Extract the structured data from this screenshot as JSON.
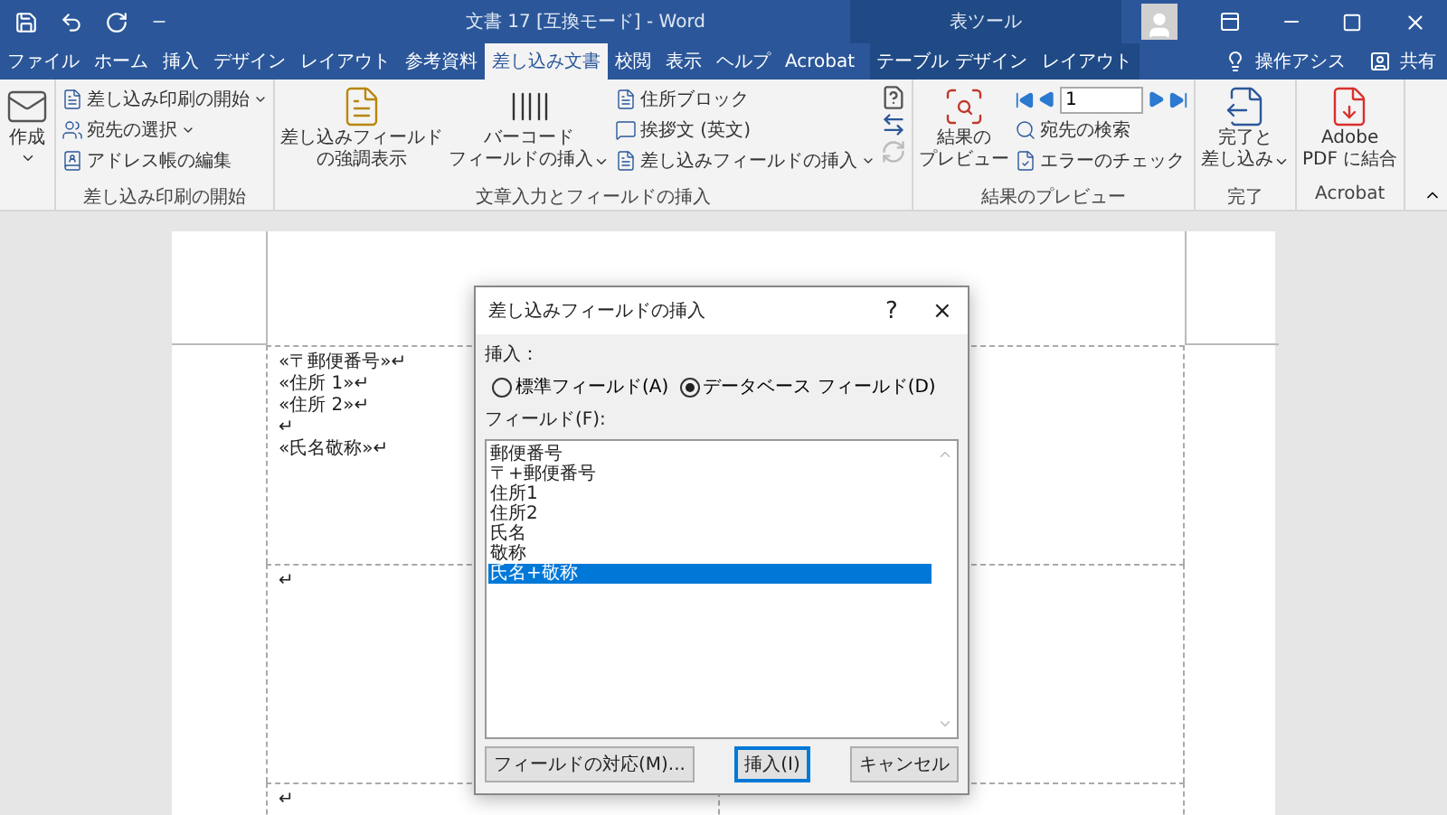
{
  "title_bar": {
    "title": "文書 17 [互換モード] - Word",
    "contextual_group": "表ツール"
  },
  "tabs": [
    {
      "label": "ファイル",
      "selected": false,
      "contextual": false
    },
    {
      "label": "ホーム",
      "selected": false,
      "contextual": false
    },
    {
      "label": "挿入",
      "selected": false,
      "contextual": false
    },
    {
      "label": "デザイン",
      "selected": false,
      "contextual": false
    },
    {
      "label": "レイアウト",
      "selected": false,
      "contextual": false
    },
    {
      "label": "参考資料",
      "selected": false,
      "contextual": false
    },
    {
      "label": "差し込み文書",
      "selected": true,
      "contextual": false
    },
    {
      "label": "校閲",
      "selected": false,
      "contextual": false
    },
    {
      "label": "表示",
      "selected": false,
      "contextual": false
    },
    {
      "label": "ヘルプ",
      "selected": false,
      "contextual": false
    },
    {
      "label": "Acrobat",
      "selected": false,
      "contextual": false
    },
    {
      "label": "テーブル デザイン",
      "selected": false,
      "contextual": true
    },
    {
      "label": "レイアウト",
      "selected": false,
      "contextual": true
    }
  ],
  "tell_me": "操作アシス",
  "share": "共有",
  "ribbon": {
    "groups": [
      {
        "items": [
          {
            "kind": "large",
            "lines": [
              "作成"
            ],
            "dropdown": true
          }
        ]
      },
      {
        "label": "差し込み印刷の開始",
        "items": [
          {
            "kind": "small",
            "label": "差し込み印刷の開始",
            "dropdown": true
          },
          {
            "kind": "small",
            "label": "宛先の選択",
            "dropdown": true
          },
          {
            "kind": "small",
            "label": "アドレス帳の編集",
            "dropdown": false
          }
        ]
      },
      {
        "label": "文章入力とフィールドの挿入",
        "items": [
          {
            "kind": "large",
            "lines": [
              "差し込みフィールド",
              "の強調表示"
            ],
            "dropdown": false
          },
          {
            "kind": "large",
            "lines": [
              "バーコード",
              "フィールドの挿入"
            ],
            "dropdown": true
          },
          {
            "kind": "small",
            "label": "住所ブロック",
            "dropdown": false
          },
          {
            "kind": "small",
            "label": "挨拶文 (英文)",
            "dropdown": false
          },
          {
            "kind": "small",
            "label": "差し込みフィールドの挿入",
            "dropdown": true
          },
          {
            "kind": "icons"
          }
        ]
      },
      {
        "label": "結果のプレビュー",
        "items": [
          {
            "kind": "large",
            "lines": [
              "結果の",
              "プレビュー"
            ],
            "dropdown": false
          },
          {
            "kind": "nav",
            "value": "1"
          },
          {
            "kind": "small",
            "label": "宛先の検索",
            "dropdown": false
          },
          {
            "kind": "small",
            "label": "エラーのチェック",
            "dropdown": false
          }
        ]
      },
      {
        "label": "完了",
        "items": [
          {
            "kind": "large",
            "lines": [
              "完了と",
              "差し込み"
            ],
            "dropdown": true
          }
        ]
      },
      {
        "label": "Acrobat",
        "items": [
          {
            "kind": "large",
            "lines": [
              "Adobe",
              "PDF に結合"
            ],
            "dropdown": false
          }
        ]
      }
    ]
  },
  "document": {
    "rows": [
      [
        [
          "«〒郵便番号»↵",
          "«住所 1»↵",
          "«住所 2»↵",
          "↵",
          "«氏名敬称»↵"
        ]
      ],
      [
        [
          "↵"
        ]
      ],
      [
        [
          "↵"
        ]
      ]
    ]
  },
  "dialog": {
    "title": "差し込みフィールドの挿入",
    "help": "?",
    "close": "×",
    "insert_label": "挿入：",
    "options": [
      {
        "label": "標準フィールド(A)",
        "selected": false
      },
      {
        "label": "データベース フィールド(D)",
        "selected": true
      }
    ],
    "field_label": "フィールド(F):",
    "fields": [
      {
        "label": "郵便番号",
        "selected": false
      },
      {
        "label": "〒+郵便番号",
        "selected": false
      },
      {
        "label": "住所1",
        "selected": false
      },
      {
        "label": "住所2",
        "selected": false
      },
      {
        "label": "氏名",
        "selected": false
      },
      {
        "label": "敬称",
        "selected": false
      },
      {
        "label": "氏名+敬称",
        "selected": true
      }
    ],
    "buttons": [
      {
        "label": "フィールドの対応(M)...",
        "default": false
      },
      {
        "label": "挿入(I)",
        "default": true
      },
      {
        "label": "キャンセル",
        "default": false
      }
    ]
  }
}
